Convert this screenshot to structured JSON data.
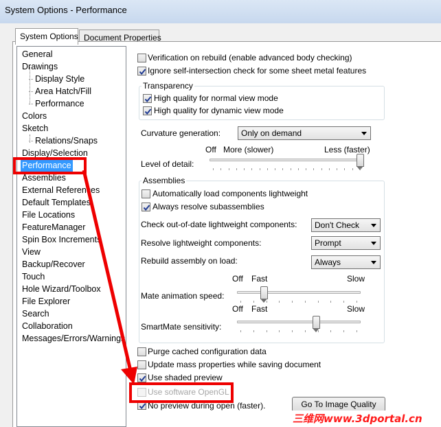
{
  "window": {
    "title": "System Options - Performance"
  },
  "tabs": [
    {
      "label": "System Options",
      "active": true
    },
    {
      "label": "Document Properties",
      "active": false
    }
  ],
  "tree": {
    "items": [
      {
        "label": "General"
      },
      {
        "label": "Drawings"
      },
      {
        "label": "Display Style"
      },
      {
        "label": "Area Hatch/Fill"
      },
      {
        "label": "Performance"
      },
      {
        "label": "Colors"
      },
      {
        "label": "Sketch"
      },
      {
        "label": "Relations/Snaps"
      },
      {
        "label": "Display/Selection"
      },
      {
        "label": "Performance",
        "selected": true
      },
      {
        "label": "Assemblies"
      },
      {
        "label": "External References"
      },
      {
        "label": "Default Templates"
      },
      {
        "label": "File Locations"
      },
      {
        "label": "FeatureManager"
      },
      {
        "label": "Spin Box Increments"
      },
      {
        "label": "View"
      },
      {
        "label": "Backup/Recover"
      },
      {
        "label": "Touch"
      },
      {
        "label": "Hole Wizard/Toolbox"
      },
      {
        "label": "File Explorer"
      },
      {
        "label": "Search"
      },
      {
        "label": "Collaboration"
      },
      {
        "label": "Messages/Errors/Warnings"
      }
    ]
  },
  "options": {
    "verification": {
      "label": "Verification on rebuild (enable advanced body checking)",
      "checked": false
    },
    "ignore_self_intersection": {
      "label": "Ignore self-intersection check for some sheet metal features",
      "checked": true
    }
  },
  "transparency": {
    "title": "Transparency",
    "normal": {
      "label": "High quality for normal view mode",
      "checked": true
    },
    "dynamic": {
      "label": "High quality for dynamic view mode",
      "checked": true
    }
  },
  "curvature": {
    "label": "Curvature generation:",
    "value": "Only on demand"
  },
  "level_of_detail": {
    "label": "Level of detail:",
    "off": "Off",
    "more": "More (slower)",
    "less": "Less (faster)",
    "position": 1.0
  },
  "assemblies": {
    "title": "Assemblies",
    "auto_lightweight": {
      "label": "Automatically load components lightweight",
      "checked": false
    },
    "always_resolve": {
      "label": "Always resolve subassemblies",
      "checked": true
    },
    "check_out_of_date": {
      "label": "Check out-of-date lightweight components:",
      "value": "Don't Check"
    },
    "resolve_lightweight": {
      "label": "Resolve lightweight components:",
      "value": "Prompt"
    },
    "rebuild_on_load": {
      "label": "Rebuild assembly on load:",
      "value": "Always"
    },
    "mate_animation": {
      "label": "Mate animation speed:",
      "off": "Off",
      "fast": "Fast",
      "slow": "Slow",
      "position": 0.2
    },
    "smartmate": {
      "label": "SmartMate sensitivity:",
      "off": "Off",
      "fast": "Fast",
      "slow": "Slow",
      "position": 0.65
    }
  },
  "bottom_options": {
    "purge_cache": {
      "label": "Purge cached configuration data",
      "checked": false
    },
    "update_mass": {
      "label": "Update mass properties while saving document",
      "checked": false
    },
    "shaded_preview": {
      "label": "Use shaded preview",
      "checked": true
    },
    "software_opengl": {
      "label": "Use software OpenGL",
      "checked": false,
      "disabled": true
    },
    "no_preview": {
      "label": "No preview during open (faster).",
      "checked": true
    }
  },
  "image_quality_button": {
    "label": "Go To Image Quality"
  },
  "watermark": {
    "text": "三维网www.3dportal.cn"
  },
  "colors": {
    "highlight": "#ee0000",
    "selection": "#3399ff"
  }
}
